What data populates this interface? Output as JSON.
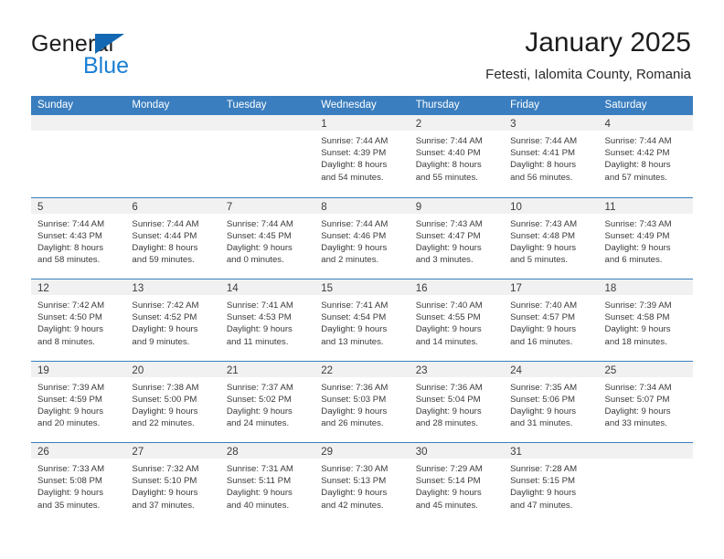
{
  "brand": {
    "word_one": "General",
    "word_two": "Blue",
    "triangle_icon": "brand-triangle-icon",
    "accent_dark": "#1268b3",
    "accent_light": "#1a7fd4"
  },
  "header": {
    "title": "January 2025",
    "subtitle": "Fetesti, Ialomita County, Romania"
  },
  "theme": {
    "header_blue": "#3a7ebf",
    "day_band_gray": "#f1f1f1",
    "text": "#3a3a3a"
  },
  "weekdays": [
    "Sunday",
    "Monday",
    "Tuesday",
    "Wednesday",
    "Thursday",
    "Friday",
    "Saturday"
  ],
  "weeks": [
    [
      {
        "day": "",
        "lines": []
      },
      {
        "day": "",
        "lines": []
      },
      {
        "day": "",
        "lines": []
      },
      {
        "day": "1",
        "lines": [
          "Sunrise: 7:44 AM",
          "Sunset: 4:39 PM",
          "Daylight: 8 hours",
          "and 54 minutes."
        ]
      },
      {
        "day": "2",
        "lines": [
          "Sunrise: 7:44 AM",
          "Sunset: 4:40 PM",
          "Daylight: 8 hours",
          "and 55 minutes."
        ]
      },
      {
        "day": "3",
        "lines": [
          "Sunrise: 7:44 AM",
          "Sunset: 4:41 PM",
          "Daylight: 8 hours",
          "and 56 minutes."
        ]
      },
      {
        "day": "4",
        "lines": [
          "Sunrise: 7:44 AM",
          "Sunset: 4:42 PM",
          "Daylight: 8 hours",
          "and 57 minutes."
        ]
      }
    ],
    [
      {
        "day": "5",
        "lines": [
          "Sunrise: 7:44 AM",
          "Sunset: 4:43 PM",
          "Daylight: 8 hours",
          "and 58 minutes."
        ]
      },
      {
        "day": "6",
        "lines": [
          "Sunrise: 7:44 AM",
          "Sunset: 4:44 PM",
          "Daylight: 8 hours",
          "and 59 minutes."
        ]
      },
      {
        "day": "7",
        "lines": [
          "Sunrise: 7:44 AM",
          "Sunset: 4:45 PM",
          "Daylight: 9 hours",
          "and 0 minutes."
        ]
      },
      {
        "day": "8",
        "lines": [
          "Sunrise: 7:44 AM",
          "Sunset: 4:46 PM",
          "Daylight: 9 hours",
          "and 2 minutes."
        ]
      },
      {
        "day": "9",
        "lines": [
          "Sunrise: 7:43 AM",
          "Sunset: 4:47 PM",
          "Daylight: 9 hours",
          "and 3 minutes."
        ]
      },
      {
        "day": "10",
        "lines": [
          "Sunrise: 7:43 AM",
          "Sunset: 4:48 PM",
          "Daylight: 9 hours",
          "and 5 minutes."
        ]
      },
      {
        "day": "11",
        "lines": [
          "Sunrise: 7:43 AM",
          "Sunset: 4:49 PM",
          "Daylight: 9 hours",
          "and 6 minutes."
        ]
      }
    ],
    [
      {
        "day": "12",
        "lines": [
          "Sunrise: 7:42 AM",
          "Sunset: 4:50 PM",
          "Daylight: 9 hours",
          "and 8 minutes."
        ]
      },
      {
        "day": "13",
        "lines": [
          "Sunrise: 7:42 AM",
          "Sunset: 4:52 PM",
          "Daylight: 9 hours",
          "and 9 minutes."
        ]
      },
      {
        "day": "14",
        "lines": [
          "Sunrise: 7:41 AM",
          "Sunset: 4:53 PM",
          "Daylight: 9 hours",
          "and 11 minutes."
        ]
      },
      {
        "day": "15",
        "lines": [
          "Sunrise: 7:41 AM",
          "Sunset: 4:54 PM",
          "Daylight: 9 hours",
          "and 13 minutes."
        ]
      },
      {
        "day": "16",
        "lines": [
          "Sunrise: 7:40 AM",
          "Sunset: 4:55 PM",
          "Daylight: 9 hours",
          "and 14 minutes."
        ]
      },
      {
        "day": "17",
        "lines": [
          "Sunrise: 7:40 AM",
          "Sunset: 4:57 PM",
          "Daylight: 9 hours",
          "and 16 minutes."
        ]
      },
      {
        "day": "18",
        "lines": [
          "Sunrise: 7:39 AM",
          "Sunset: 4:58 PM",
          "Daylight: 9 hours",
          "and 18 minutes."
        ]
      }
    ],
    [
      {
        "day": "19",
        "lines": [
          "Sunrise: 7:39 AM",
          "Sunset: 4:59 PM",
          "Daylight: 9 hours",
          "and 20 minutes."
        ]
      },
      {
        "day": "20",
        "lines": [
          "Sunrise: 7:38 AM",
          "Sunset: 5:00 PM",
          "Daylight: 9 hours",
          "and 22 minutes."
        ]
      },
      {
        "day": "21",
        "lines": [
          "Sunrise: 7:37 AM",
          "Sunset: 5:02 PM",
          "Daylight: 9 hours",
          "and 24 minutes."
        ]
      },
      {
        "day": "22",
        "lines": [
          "Sunrise: 7:36 AM",
          "Sunset: 5:03 PM",
          "Daylight: 9 hours",
          "and 26 minutes."
        ]
      },
      {
        "day": "23",
        "lines": [
          "Sunrise: 7:36 AM",
          "Sunset: 5:04 PM",
          "Daylight: 9 hours",
          "and 28 minutes."
        ]
      },
      {
        "day": "24",
        "lines": [
          "Sunrise: 7:35 AM",
          "Sunset: 5:06 PM",
          "Daylight: 9 hours",
          "and 31 minutes."
        ]
      },
      {
        "day": "25",
        "lines": [
          "Sunrise: 7:34 AM",
          "Sunset: 5:07 PM",
          "Daylight: 9 hours",
          "and 33 minutes."
        ]
      }
    ],
    [
      {
        "day": "26",
        "lines": [
          "Sunrise: 7:33 AM",
          "Sunset: 5:08 PM",
          "Daylight: 9 hours",
          "and 35 minutes."
        ]
      },
      {
        "day": "27",
        "lines": [
          "Sunrise: 7:32 AM",
          "Sunset: 5:10 PM",
          "Daylight: 9 hours",
          "and 37 minutes."
        ]
      },
      {
        "day": "28",
        "lines": [
          "Sunrise: 7:31 AM",
          "Sunset: 5:11 PM",
          "Daylight: 9 hours",
          "and 40 minutes."
        ]
      },
      {
        "day": "29",
        "lines": [
          "Sunrise: 7:30 AM",
          "Sunset: 5:13 PM",
          "Daylight: 9 hours",
          "and 42 minutes."
        ]
      },
      {
        "day": "30",
        "lines": [
          "Sunrise: 7:29 AM",
          "Sunset: 5:14 PM",
          "Daylight: 9 hours",
          "and 45 minutes."
        ]
      },
      {
        "day": "31",
        "lines": [
          "Sunrise: 7:28 AM",
          "Sunset: 5:15 PM",
          "Daylight: 9 hours",
          "and 47 minutes."
        ]
      },
      {
        "day": "",
        "lines": []
      }
    ]
  ]
}
